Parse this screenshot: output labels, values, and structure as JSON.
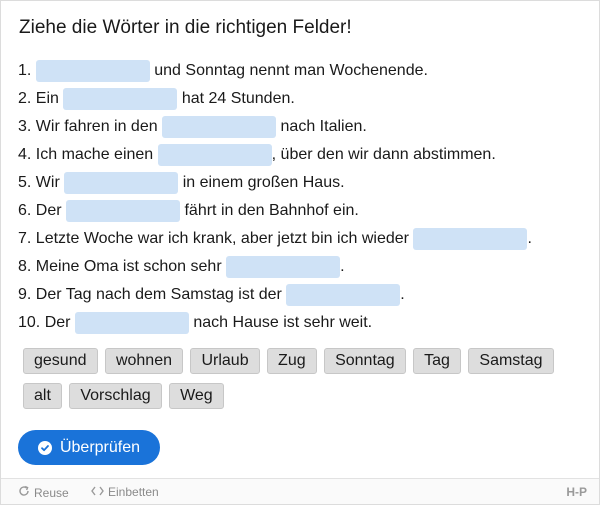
{
  "title": "Ziehe die Wörter in die richtigen Felder!",
  "sentences": [
    {
      "before": "1.",
      "after": "und Sonntag nennt man Wochenende."
    },
    {
      "before": "2. Ein",
      "after": "hat 24 Stunden."
    },
    {
      "before": "3. Wir fahren in den",
      "after": "nach Italien."
    },
    {
      "before": "4. Ich mache einen",
      "after": ", über den wir dann abstimmen."
    },
    {
      "before": "5. Wir",
      "after": "in einem großen Haus."
    },
    {
      "before": "6. Der",
      "after": "fährt in den Bahnhof ein."
    },
    {
      "before": "7. Letzte Woche war ich krank, aber jetzt bin ich wieder",
      "after": "."
    },
    {
      "before": "8. Meine Oma ist schon sehr",
      "after": "."
    },
    {
      "before": "9. Der Tag nach dem Samstag ist der",
      "after": "."
    },
    {
      "before": "10. Der",
      "after": "nach Hause ist sehr weit."
    }
  ],
  "words": [
    "gesund",
    "wohnen",
    "Urlaub",
    "Zug",
    "Sonntag",
    "Tag",
    "Samstag",
    "alt",
    "Vorschlag",
    "Weg"
  ],
  "check_button": {
    "label": "Überprüfen",
    "icon": "check-circle-icon",
    "color": "#1a73d9"
  },
  "footer": {
    "reuse": "Reuse",
    "embed": "Einbetten",
    "brand": "H-P"
  },
  "colors": {
    "drop_zone": "#cfe2f6",
    "chip_bg": "#dddddd"
  }
}
